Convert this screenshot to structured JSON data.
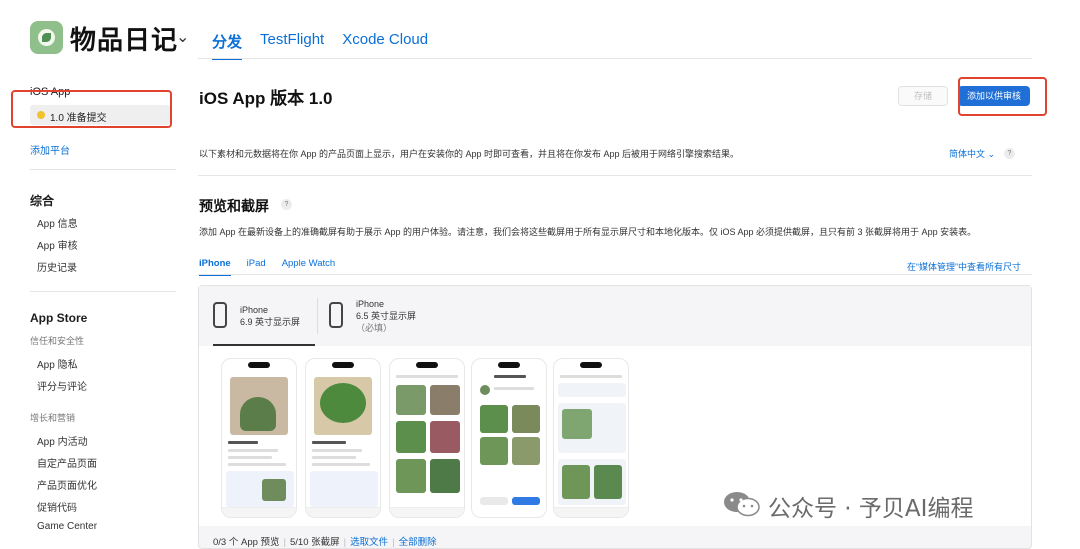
{
  "header": {
    "app_name": "物品日记",
    "tabs": [
      {
        "label": "分发",
        "active": true
      },
      {
        "label": "TestFlight",
        "active": false
      },
      {
        "label": "Xcode Cloud",
        "active": false
      }
    ]
  },
  "sidebar": {
    "ios_heading": "iOS App",
    "version": {
      "label": "1.0 准备提交",
      "status_color": "#f2c12e"
    },
    "add_platform": "添加平台",
    "general_heading": "综合",
    "general_items": [
      "App 信息",
      "App 审核",
      "历史记录"
    ],
    "store_heading": "App Store",
    "trust_sub": "信任和安全性",
    "trust_items": [
      "App 隐私",
      "评分与评论"
    ],
    "growth_sub": "增长和营销",
    "growth_items": [
      "App 内活动",
      "自定产品页面",
      "产品页面优化",
      "促销代码",
      "Game Center"
    ]
  },
  "main": {
    "title": "iOS App 版本 1.0",
    "save_button": "存储",
    "submit_button": "添加以供审核",
    "intro": "以下素材和元数据将在你 App 的产品页面上显示，用户在安装你的 App 时即可查看，并且将在你发布 App 后被用于网络引擎搜索结果。",
    "language": "简体中文",
    "help": "?",
    "preview_title": "预览和截屏",
    "preview_desc": "添加 App 在最新设备上的准确截屏有助于展示 App 的用户体验。请注意，我们会将这些截屏用于所有显示屏尺寸和本地化版本。仅 iOS App 必须提供截屏，且只有前 3 张截屏将用于 App 安装表。",
    "device_tabs": [
      {
        "label": "iPhone",
        "active": true
      },
      {
        "label": "iPad",
        "active": false
      },
      {
        "label": "Apple Watch",
        "active": false
      }
    ],
    "media_link": "在“媒体管理”中查看所有尺寸",
    "size_tabs": [
      {
        "line1": "iPhone",
        "line2": "6.9 英寸显示屏",
        "line3": "",
        "active": true
      },
      {
        "line1": "iPhone",
        "line2": "6.5 英寸显示屏",
        "line3": "（必填）",
        "active": false
      }
    ],
    "bottom": {
      "preview_count": "0/3 个 App 预览",
      "screenshot_count": "5/10 张截屏",
      "choose_file": "选取文件",
      "delete_all": "全部删除"
    }
  },
  "watermark": {
    "text": "公众号 · 予贝AI编程"
  }
}
